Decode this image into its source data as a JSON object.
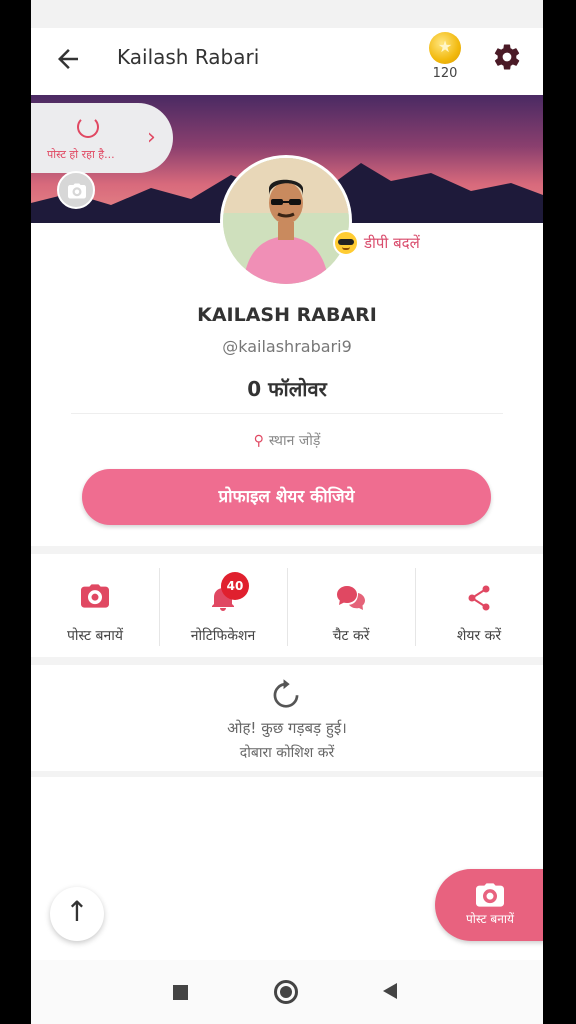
{
  "header": {
    "title": "Kailash Rabari",
    "coins": "120",
    "icons": {
      "back": "back-arrow-icon",
      "coin": "star-coin-icon",
      "settings": "gear-icon"
    }
  },
  "cover": {
    "posting_text": "पोस्ट हो रहा है...",
    "icons": {
      "camera": "camera-icon",
      "chevron": "chevron-right-icon"
    }
  },
  "profile": {
    "change_dp_label": "डीपी बदलें",
    "name": "KAILASH RABARI",
    "handle": "@kailashrabari9",
    "followers": "0 फॉलोवर",
    "location": "स्थान जोड़ें",
    "share_button": "प्रोफाइल शेयर कीजिये"
  },
  "actions": [
    {
      "label": "पोस्ट बनायें",
      "icon": "camera-icon"
    },
    {
      "label": "नोटिफिकेशन",
      "icon": "bell-icon",
      "badge": "40"
    },
    {
      "label": "चैट करें",
      "icon": "chat-bubbles-icon"
    },
    {
      "label": "शेयर करें",
      "icon": "share-icon"
    }
  ],
  "error": {
    "line1": "ओह! कुछ गड़बड़ हुई।",
    "line2": "दोबारा कोशिश करें"
  },
  "fab": {
    "label": "पोस्ट बनायें"
  },
  "colors": {
    "accent": "#e04862",
    "button": "#ef6d90",
    "badge": "#e0202e"
  }
}
